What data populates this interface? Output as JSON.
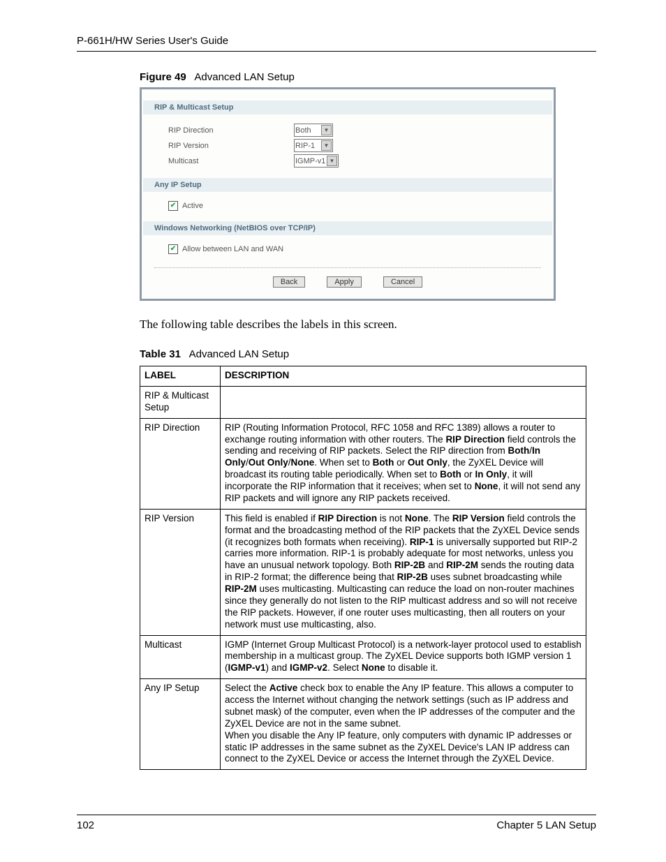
{
  "header": {
    "guide_title": "P-661H/HW Series User's Guide"
  },
  "figure": {
    "label": "Figure 49",
    "title": "Advanced LAN Setup"
  },
  "embed": {
    "section1_title": "RIP & Multicast Setup",
    "rip_direction_label": "RIP Direction",
    "rip_direction_value": "Both",
    "rip_version_label": "RIP Version",
    "rip_version_value": "RIP-1",
    "multicast_label": "Multicast",
    "multicast_value": "IGMP-v1",
    "section2_title": "Any IP Setup",
    "active_label": "Active",
    "section3_title": "Windows Networking (NetBIOS over TCP/IP)",
    "allow_label": "Allow between LAN and WAN",
    "btn_back": "Back",
    "btn_apply": "Apply",
    "btn_cancel": "Cancel"
  },
  "para1": "The following table describes the labels in this screen.",
  "table_caption": {
    "label": "Table 31",
    "title": "Advanced LAN Setup"
  },
  "table": {
    "head_label": "LABEL",
    "head_desc": "DESCRIPTION",
    "rows": [
      {
        "label": "RIP & Multicast Setup",
        "desc": ""
      },
      {
        "label": "RIP Direction",
        "desc": "RIP (Routing Information Protocol, RFC 1058 and RFC 1389) allows a router to exchange routing information with other routers. The <b>RIP Direction</b> field controls the sending and receiving of RIP packets. Select the RIP direction from <b>Both</b>/<b>In Only</b>/<b>Out Only</b>/<b>None</b>. When set to <b>Both</b> or <b>Out Only</b>, the ZyXEL Device will broadcast its routing table periodically. When set to <b>Both</b> or <b>In Only</b>, it will incorporate the RIP information that it receives; when set to <b>None</b>, it will not send any RIP packets and will ignore any RIP packets received."
      },
      {
        "label": "RIP Version",
        "desc": "This field is enabled if <b>RIP Direction</b> is not <b>None</b>. The <b>RIP Version</b> field controls the format and the broadcasting method of the RIP packets that the ZyXEL Device sends (it recognizes both formats when receiving). <b>RIP-1</b> is universally supported but RIP-2 carries more information. RIP-1 is probably adequate for most networks, unless you have an unusual network topology. Both <b>RIP-2B</b> and <b>RIP-2M</b> sends the routing data in RIP-2 format; the difference being that <b>RIP-2B</b> uses subnet broadcasting while <b>RIP-2M</b> uses multicasting. Multicasting can reduce the load on non-router machines since they generally do not listen to the RIP multicast address and so will not receive the RIP packets. However, if one router uses multicasting, then all routers on your network must use multicasting, also."
      },
      {
        "label": "Multicast",
        "desc": "IGMP (Internet Group Multicast Protocol) is a network-layer protocol used to establish membership in a multicast group. The ZyXEL Device supports both IGMP version 1 (<b>IGMP-v1</b>) and <b>IGMP-v2</b>. Select <b>None</b> to disable it."
      },
      {
        "label": "Any IP Setup",
        "desc": "Select the <b>Active</b> check box to enable the Any IP feature. This allows a computer to access the Internet without changing the network settings (such as IP address and subnet mask) of the computer, even when the IP addresses of the computer and the ZyXEL Device are not in the same subnet.<br>When you disable the Any IP feature, only computers with dynamic IP addresses or static IP addresses in the same subnet as the ZyXEL Device's LAN IP address can connect to the ZyXEL Device or access the Internet through the ZyXEL Device."
      }
    ]
  },
  "footer": {
    "page_no": "102",
    "chapter": "Chapter 5 LAN Setup"
  }
}
